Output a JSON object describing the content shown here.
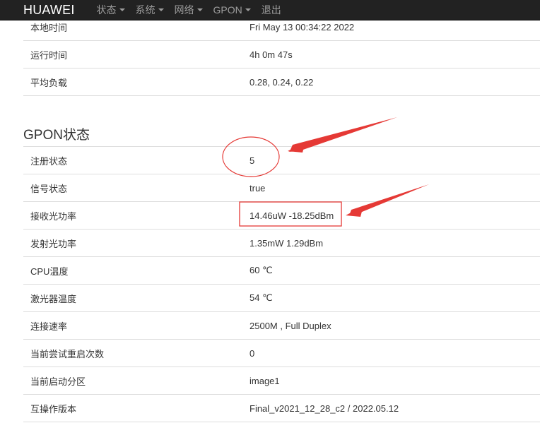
{
  "navbar": {
    "brand": "HUAWEI",
    "menu": [
      {
        "label": "状态",
        "dropdown": true
      },
      {
        "label": "系统",
        "dropdown": true
      },
      {
        "label": "网络",
        "dropdown": true
      },
      {
        "label": "GPON",
        "dropdown": true
      },
      {
        "label": "退出",
        "dropdown": false
      }
    ]
  },
  "system_table": {
    "rows": [
      {
        "label": "本地时间",
        "value": "Fri May 13 00:34:22 2022"
      },
      {
        "label": "运行时间",
        "value": "4h 0m 47s"
      },
      {
        "label": "平均负载",
        "value": "0.28, 0.24, 0.22"
      }
    ]
  },
  "gpon": {
    "title": "GPON状态",
    "rows": [
      {
        "label": "注册状态",
        "value": "5"
      },
      {
        "label": "信号状态",
        "value": "true"
      },
      {
        "label": "接收光功率",
        "value": "14.46uW -18.25dBm"
      },
      {
        "label": "发射光功率",
        "value": "1.35mW 1.29dBm"
      },
      {
        "label": "CPU温度",
        "value": "60 ℃"
      },
      {
        "label": "激光器温度",
        "value": "54 ℃"
      },
      {
        "label": "连接速率",
        "value": "2500M , Full Duplex"
      },
      {
        "label": "当前尝试重启次数",
        "value": "0"
      },
      {
        "label": "当前启动分区",
        "value": "image1"
      },
      {
        "label": "互操作版本",
        "value": "Final_v2021_12_28_c2 / 2022.05.12"
      }
    ]
  },
  "colors": {
    "navbar_bg": "#222222",
    "nav_text": "#9d9d9d",
    "annotation_red": "#e53935"
  },
  "icons": [
    "caret-down-icon",
    "red-arrow-annotation",
    "red-circle-annotation",
    "red-box-annotation"
  ]
}
